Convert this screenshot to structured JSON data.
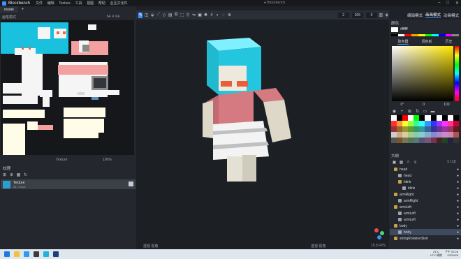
{
  "app": {
    "name": "Blockbench",
    "window_title": "● Blockbench"
  },
  "menu": [
    "文件",
    "编辑",
    "Texture",
    "工具",
    "视图",
    "帮助",
    "业互文化件"
  ],
  "tabs": {
    "items": [
      {
        "label": "model"
      }
    ],
    "add": "+"
  },
  "toolbar": {
    "num1": "2",
    "num2": "265",
    "num3": "0",
    "active_icon": "brush-icon"
  },
  "modes": [
    {
      "label": "编辑模式",
      "active": false
    },
    {
      "label": "画画模式",
      "active": true
    },
    {
      "label": "动画模式",
      "active": false
    }
  ],
  "uv": {
    "header": "画笔模式",
    "dims": "64 ✕ 64",
    "footer_label": "Texture",
    "zoom": "100%"
  },
  "textures": {
    "header": "纹理",
    "items": [
      {
        "name": "Texture",
        "sub": "64 × 64px"
      }
    ]
  },
  "color": {
    "header": "颜色",
    "hex": "#ffffff",
    "tabs": [
      "取色器",
      "调色板",
      "历史"
    ],
    "hsv": [
      "0°",
      "0",
      "100"
    ],
    "palette": [
      "#000000",
      "#ffffff",
      "#ff0000",
      "#ffa500",
      "#ffff00",
      "#00ff00",
      "#00ffff",
      "#0000ff",
      "#ff00ff",
      "#888888"
    ],
    "swatches": [
      "#ffffff",
      "#000000",
      "#ff0000",
      "#ffffff",
      "#00ff00",
      "#000000",
      "#ffffff",
      "#000000",
      "#ffffff",
      "#000000",
      "#ffffff",
      "#000000",
      "#ff3333",
      "#ff9933",
      "#ffff33",
      "#99ff33",
      "#33ff99",
      "#33ffff",
      "#3399ff",
      "#3333ff",
      "#9933ff",
      "#ff33ff",
      "#ff3399",
      "#cc0033",
      "#993333",
      "#996633",
      "#999933",
      "#669933",
      "#339966",
      "#339999",
      "#336699",
      "#333399",
      "#663399",
      "#993399",
      "#993366",
      "#661a1a",
      "#cccccc",
      "#ccaa88",
      "#ddcc99",
      "#aacc88",
      "#88ccaa",
      "#88cccc",
      "#88aacc",
      "#8888cc",
      "#aa88cc",
      "#cc88cc",
      "#cc88aa",
      "#aa5555",
      "#555555",
      "#775533",
      "#777755",
      "#557755",
      "#557777",
      "#555577",
      "#775577",
      "#773355",
      "#442222",
      "#224422",
      "#222244",
      "#333333"
    ]
  },
  "outliner": {
    "header": "大纲",
    "count": "1 / 12",
    "items": [
      {
        "label": "head",
        "type": "group",
        "indent": 1,
        "sel": false
      },
      {
        "label": "head",
        "type": "cube",
        "indent": 2,
        "sel": false
      },
      {
        "label": "blink",
        "type": "group",
        "indent": 2,
        "sel": false
      },
      {
        "label": "blink",
        "type": "cube",
        "indent": 3,
        "sel": false
      },
      {
        "label": "armRight",
        "type": "group",
        "indent": 1,
        "sel": false
      },
      {
        "label": "armRight",
        "type": "cube",
        "indent": 2,
        "sel": false
      },
      {
        "label": "armLeft",
        "type": "group",
        "indent": 1,
        "sel": false
      },
      {
        "label": "armLeft",
        "type": "cube",
        "indent": 2,
        "sel": false
      },
      {
        "label": "armLeft",
        "type": "cube",
        "indent": 2,
        "sel": false
      },
      {
        "label": "body",
        "type": "group",
        "indent": 1,
        "sel": false
      },
      {
        "label": "body",
        "type": "cube",
        "indent": 2,
        "sel": true
      },
      {
        "label": "stringRotationSkirt",
        "type": "group",
        "indent": 1,
        "sel": false
      }
    ]
  },
  "viewport": {
    "footer_left": "透视 视角",
    "footer_mid": "透视 视角",
    "fps": "15.5 FPS"
  },
  "taskbar": {
    "weather": "24°C",
    "weather_sub": "UTV 晴朗",
    "time": "下午 02:26",
    "date": "2023/6/8"
  }
}
